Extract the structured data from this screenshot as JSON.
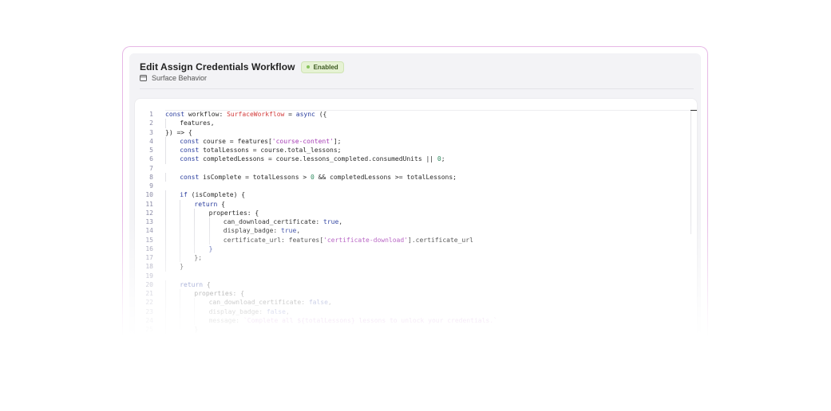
{
  "header": {
    "title": "Edit Assign Credentials Workflow",
    "status_badge": "Enabled",
    "subtitle": "Surface Behavior",
    "subtitle_icon": "calendar-icon"
  },
  "colors": {
    "card_border": "#e7b8e6",
    "badge_bg": "#e6f2d4",
    "badge_dot": "#86c25c",
    "keyword": "#2a3d9e",
    "type": "#d33b3b",
    "string": "#a53cb5",
    "number": "#2d8a5e",
    "line_number": "#8a8aa5"
  },
  "editor": {
    "lines": [
      {
        "n": "1",
        "indent": 0,
        "tokens": [
          [
            "kw",
            "const "
          ],
          [
            "p",
            "workflow: "
          ],
          [
            "ty",
            "SurfaceWorkflow"
          ],
          [
            "p",
            " = "
          ],
          [
            "kw",
            "async"
          ],
          [
            "p",
            " ({"
          ]
        ]
      },
      {
        "n": "2",
        "indent": 1,
        "tokens": [
          [
            "p",
            "features,"
          ]
        ]
      },
      {
        "n": "3",
        "indent": 0,
        "tokens": [
          [
            "p",
            "}) => {"
          ]
        ]
      },
      {
        "n": "4",
        "indent": 1,
        "tokens": [
          [
            "kw",
            "const "
          ],
          [
            "p",
            "course = features["
          ],
          [
            "st",
            "'course-content'"
          ],
          [
            "p",
            "];"
          ]
        ]
      },
      {
        "n": "5",
        "indent": 1,
        "tokens": [
          [
            "kw",
            "const "
          ],
          [
            "p",
            "totalLessons = course.total_lessons;"
          ]
        ]
      },
      {
        "n": "6",
        "indent": 1,
        "tokens": [
          [
            "kw",
            "const "
          ],
          [
            "p",
            "completedLessons = course.lessons_completed.consumedUnits || "
          ],
          [
            "nu",
            "0"
          ],
          [
            "p",
            ";"
          ]
        ]
      },
      {
        "n": "7",
        "indent": 0,
        "tokens": []
      },
      {
        "n": "8",
        "indent": 1,
        "tokens": [
          [
            "kw",
            "const "
          ],
          [
            "p",
            "isComplete = totalLessons > "
          ],
          [
            "nu",
            "0"
          ],
          [
            "p",
            " && completedLessons >= totalLessons;"
          ]
        ]
      },
      {
        "n": "9",
        "indent": 0,
        "tokens": []
      },
      {
        "n": "10",
        "indent": 1,
        "tokens": [
          [
            "kw",
            "if"
          ],
          [
            "p",
            " (isComplete) {"
          ]
        ]
      },
      {
        "n": "11",
        "indent": 2,
        "tokens": [
          [
            "kw",
            "return"
          ],
          [
            "p",
            " {"
          ]
        ]
      },
      {
        "n": "12",
        "indent": 3,
        "tokens": [
          [
            "p",
            "properties: {"
          ]
        ]
      },
      {
        "n": "13",
        "indent": 4,
        "tokens": [
          [
            "p",
            "can_download_certificate: "
          ],
          [
            "kw",
            "true"
          ],
          [
            "p",
            ","
          ]
        ]
      },
      {
        "n": "14",
        "indent": 4,
        "tokens": [
          [
            "p",
            "display_badge: "
          ],
          [
            "kw",
            "true"
          ],
          [
            "p",
            ","
          ]
        ]
      },
      {
        "n": "15",
        "indent": 4,
        "tokens": [
          [
            "p",
            "certificate_url: features["
          ],
          [
            "st",
            "'certificate-download'"
          ],
          [
            "p",
            "].certificate_url"
          ]
        ]
      },
      {
        "n": "16",
        "indent": 3,
        "tokens": [
          [
            "kw",
            "}"
          ]
        ]
      },
      {
        "n": "17",
        "indent": 2,
        "tokens": [
          [
            "p",
            "};"
          ]
        ]
      },
      {
        "n": "18",
        "indent": 1,
        "tokens": [
          [
            "p",
            "}"
          ]
        ]
      },
      {
        "n": "19",
        "indent": 0,
        "tokens": []
      },
      {
        "n": "20",
        "indent": 1,
        "tokens": [
          [
            "kw",
            "return"
          ],
          [
            "p",
            " {"
          ]
        ]
      },
      {
        "n": "21",
        "indent": 2,
        "tokens": [
          [
            "p",
            "properties: {"
          ]
        ]
      },
      {
        "n": "22",
        "indent": 3,
        "tokens": [
          [
            "p",
            "can_download_certificate: "
          ],
          [
            "kw",
            "false"
          ],
          [
            "p",
            ","
          ]
        ]
      },
      {
        "n": "23",
        "indent": 3,
        "tokens": [
          [
            "p",
            "display_badge: "
          ],
          [
            "kw",
            "false"
          ],
          [
            "p",
            ","
          ]
        ]
      },
      {
        "n": "24",
        "indent": 3,
        "tokens": [
          [
            "p",
            "message: "
          ],
          [
            "st",
            "`Complete all ${totalLessons} lessons to unlock your credentials.`"
          ]
        ]
      },
      {
        "n": "25",
        "indent": 2,
        "tokens": [
          [
            "p",
            "}"
          ]
        ]
      }
    ]
  }
}
